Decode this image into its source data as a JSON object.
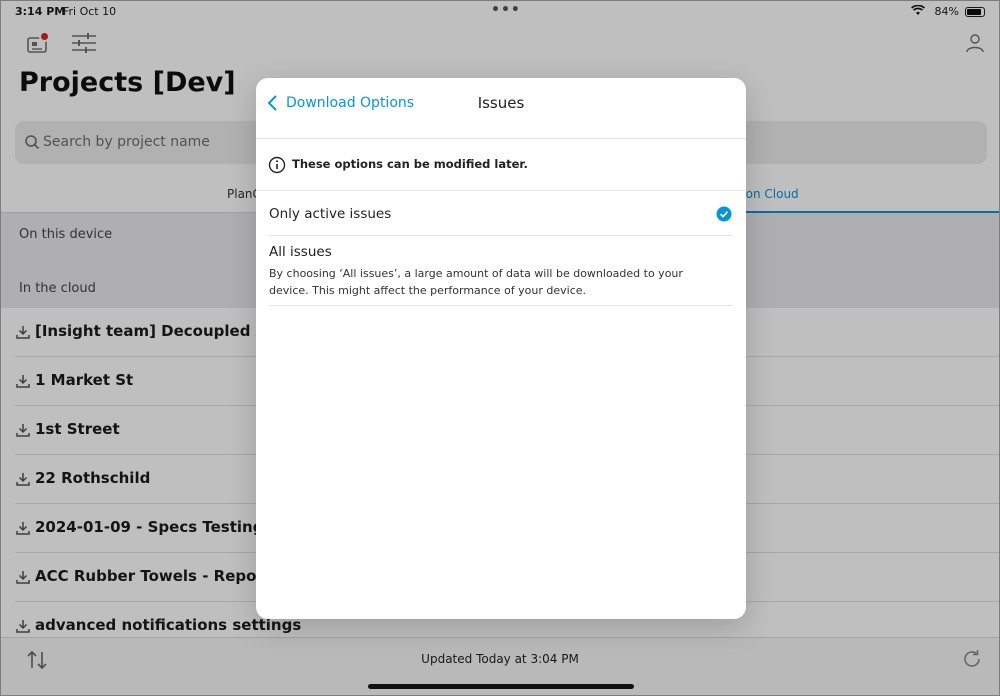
{
  "status_bar": {
    "time": "3:14 PM",
    "date": "Fri Oct 10",
    "battery": "84%"
  },
  "header": {
    "title": "Projects [Dev]"
  },
  "search": {
    "placeholder": "Search by project name"
  },
  "tabs": [
    {
      "label": "PlanG"
    },
    {
      "label": "ction Cloud"
    }
  ],
  "sections": {
    "on_device": "On this device",
    "in_cloud": "In the cloud"
  },
  "projects": [
    {
      "name": "[Insight team] Decoupled ACC"
    },
    {
      "name": "1 Market St"
    },
    {
      "name": "1st Street"
    },
    {
      "name": "22 Rothschild"
    },
    {
      "name": "2024-01-09 - Specs Testing"
    },
    {
      "name": "ACC Rubber Towels - Reports Q"
    },
    {
      "name": "advanced notifications settings"
    }
  ],
  "footer": {
    "updated": "Updated Today at 3:04 PM"
  },
  "modal": {
    "back_label": "Download Options",
    "title": "Issues",
    "info": "These options can be modified later.",
    "options": [
      {
        "label": "Only active issues",
        "selected": true,
        "description": ""
      },
      {
        "label": "All issues",
        "selected": false,
        "description": "By choosing ‘All issues’, a large amount of data will be downloaded to your device. This might affect the performance of your device."
      }
    ]
  },
  "colors": {
    "accent": "#0696d7",
    "badge": "#d8232a"
  }
}
